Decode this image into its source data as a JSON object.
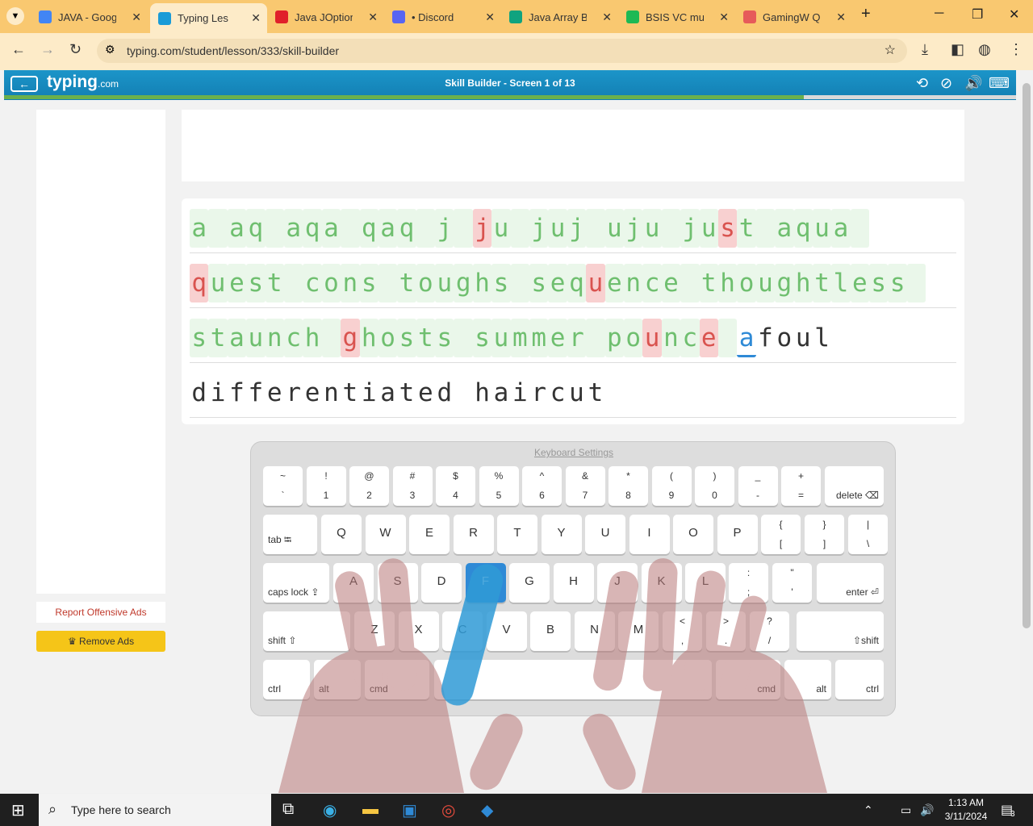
{
  "tabs": [
    {
      "title": "JAVA - Google",
      "color": "#4285f4"
    },
    {
      "title": "Typing Les",
      "color": "#1a9bd7"
    },
    {
      "title": "Java JOptionP",
      "color": "#e0202a"
    },
    {
      "title": "• Discord",
      "color": "#5865f2"
    },
    {
      "title": "Java Array Bas",
      "color": "#10a37f"
    },
    {
      "title": "BSIS VC music",
      "color": "#1db954"
    },
    {
      "title": "GamingW QU",
      "color": "#e65a5a"
    }
  ],
  "address": {
    "url": "typing.com/student/lesson/333/skill-builder"
  },
  "header": {
    "logo": "typing",
    "logo_suffix": ".com",
    "title": "Skill Builder - Screen 1 of 13",
    "progress": 0.79
  },
  "sidebar": {
    "report": "Report Offensive Ads",
    "remove": "♛ Remove Ads"
  },
  "lesson": {
    "lines": [
      "a aq aqa qaq j ju juj uju just aqua ",
      "quest cons toughs sequence thoughtless ",
      "staunch ghosts summer pounce afoul",
      "differentiated haircut"
    ],
    "errors": {
      "0": [
        15,
        28,
        39
      ],
      "1": [
        0,
        21
      ],
      "2": [
        8,
        24,
        27
      ],
      "3": []
    },
    "cursor": {
      "line": 2,
      "index": 29
    },
    "typed_until": {
      "line": 2,
      "index": 29
    }
  },
  "keyboard": {
    "settings": "Keyboard Settings",
    "highlight": "F",
    "row1": [
      [
        "~",
        "`"
      ],
      [
        "!",
        "1"
      ],
      [
        "@",
        "2"
      ],
      [
        "#",
        "3"
      ],
      [
        "$",
        "4"
      ],
      [
        "%",
        "5"
      ],
      [
        "^",
        "6"
      ],
      [
        "&",
        "7"
      ],
      [
        "*",
        "8"
      ],
      [
        "(",
        "9"
      ],
      [
        ")",
        "0"
      ],
      [
        "_",
        "-"
      ],
      [
        "+",
        "="
      ]
    ],
    "delete": "delete ⌫",
    "tab": "tab ⭾",
    "row2": [
      "Q",
      "W",
      "E",
      "R",
      "T",
      "Y",
      "U",
      "I",
      "O",
      "P"
    ],
    "row2sym": [
      [
        "{",
        "["
      ],
      [
        "}",
        "]"
      ],
      [
        "|",
        "\\"
      ]
    ],
    "caps": "caps lock ⇪",
    "row3": [
      "A",
      "S",
      "D",
      "F",
      "G",
      "H",
      "J",
      "K",
      "L"
    ],
    "row3sym": [
      [
        ":",
        ";"
      ],
      [
        "\"",
        "'"
      ]
    ],
    "enter": "enter ⏎",
    "shift_l": "shift ⇧",
    "row4": [
      "Z",
      "X",
      "C",
      "V",
      "B",
      "N",
      "M"
    ],
    "row4sym": [
      [
        "<",
        ","
      ],
      [
        ">",
        "."
      ],
      [
        "?",
        "/"
      ]
    ],
    "shift_r": "⇧shift",
    "bottom": {
      "ctrl": "ctrl",
      "alt": "alt",
      "cmd": "cmd"
    }
  },
  "taskbar": {
    "search": "Type here to search",
    "time": "1:13 AM",
    "date": "3/11/2024",
    "notif": "3"
  }
}
